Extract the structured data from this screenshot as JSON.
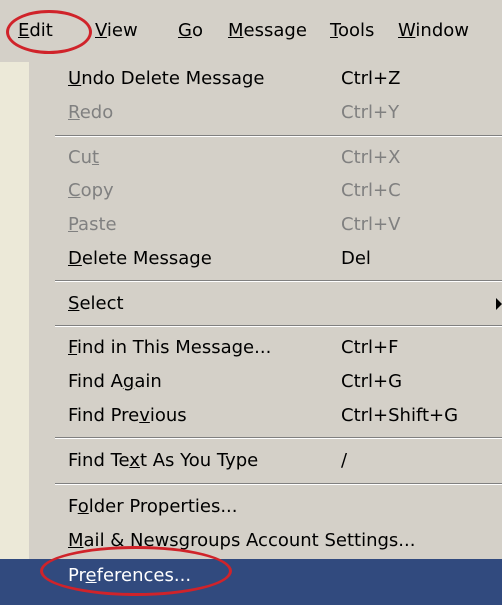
{
  "menubar": {
    "items": [
      {
        "mn": "E",
        "rest": "dit"
      },
      {
        "mn": "V",
        "rest": "iew"
      },
      {
        "mn": "G",
        "rest": "o"
      },
      {
        "mn": "M",
        "rest": "essage"
      },
      {
        "mn": "T",
        "rest": "ools"
      },
      {
        "mn": "W",
        "rest": "indow"
      }
    ]
  },
  "menu": {
    "undo": {
      "pre": "",
      "mn": "U",
      "post": "ndo Delete Message",
      "shortcut": "Ctrl+Z"
    },
    "redo": {
      "pre": "",
      "mn": "R",
      "post": "edo",
      "shortcut": "Ctrl+Y"
    },
    "cut": {
      "pre": "Cu",
      "mn": "t",
      "post": "",
      "shortcut": "Ctrl+X"
    },
    "copy": {
      "pre": "",
      "mn": "C",
      "post": "opy",
      "shortcut": "Ctrl+C"
    },
    "paste": {
      "pre": "",
      "mn": "P",
      "post": "aste",
      "shortcut": "Ctrl+V"
    },
    "delete": {
      "pre": "",
      "mn": "D",
      "post": "elete Message",
      "shortcut": "Del"
    },
    "select": {
      "pre": "",
      "mn": "S",
      "post": "elect"
    },
    "find_msg": {
      "pre": "",
      "mn": "F",
      "post": "ind in This Message...",
      "shortcut": "Ctrl+F"
    },
    "find_again": {
      "pre": "Find A",
      "mn": "g",
      "post": "ain",
      "shortcut": "Ctrl+G"
    },
    "find_prev": {
      "pre": "Find Pre",
      "mn": "v",
      "post": "ious",
      "shortcut": "Ctrl+Shift+G"
    },
    "find_type": {
      "pre": "Find Te",
      "mn": "x",
      "post": "t As You Type",
      "shortcut": "/"
    },
    "folder_props": {
      "pre": "F",
      "mn": "o",
      "post": "lder Properties..."
    },
    "mail_settings": {
      "pre": "",
      "mn": "M",
      "post": "ail & Newsgroups Account Settings..."
    },
    "preferences": {
      "pre": "Pr",
      "mn": "e",
      "post": "ferences..."
    }
  },
  "colors": {
    "highlight": "#314a7e",
    "annotation": "#d0232a",
    "menu_bg": "#d4d0c8",
    "disabled_text": "#808080"
  },
  "icons": {
    "submenu": "submenu-arrow-icon"
  }
}
